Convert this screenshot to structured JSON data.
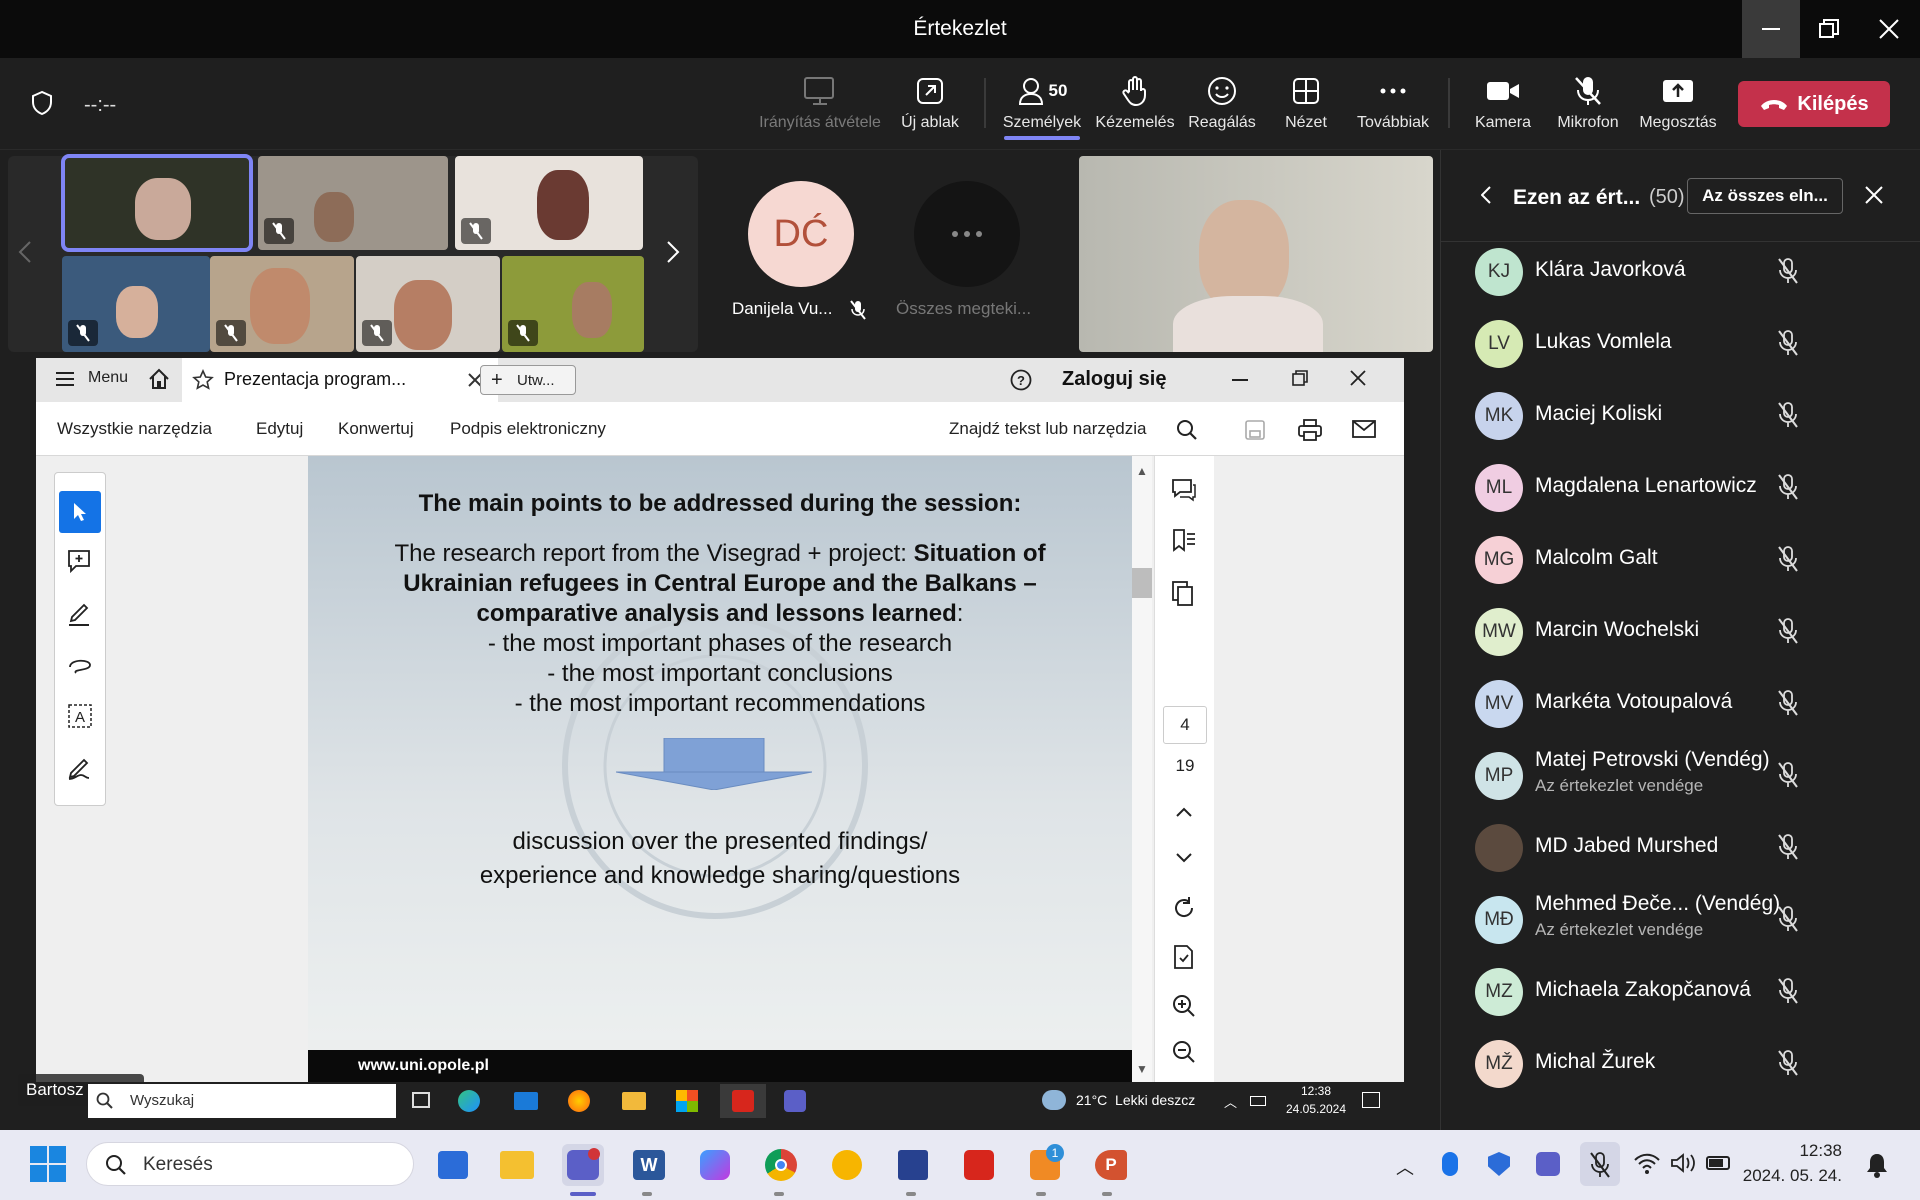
{
  "window": {
    "title": "Értekezlet"
  },
  "toolbar": {
    "timer": "--:--",
    "control": "Irányítás átvétele",
    "new_window": "Új ablak",
    "people": "Személyek",
    "people_count": "50",
    "raise_hand": "Kézemelés",
    "react": "Reagálás",
    "view": "Nézet",
    "more": "Továbbiak",
    "camera": "Kamera",
    "mic": "Mikrofon",
    "share": "Megosztás",
    "leave": "Kilépés"
  },
  "stage": {
    "participant_initials": "DĆ",
    "participant_name": "Danijela Vu...",
    "view_all": "Összes megteki...",
    "speaker_label": "Bartosz Czepil"
  },
  "panel": {
    "title": "Ezen az ért...",
    "count": "(50)",
    "mute_all": "Az összes eln...",
    "people": [
      {
        "initials": "KJ",
        "name": "Klára Javorková",
        "sub": "",
        "color": "#bfe5cf"
      },
      {
        "initials": "LV",
        "name": "Lukas Vomlela",
        "sub": "",
        "color": "#d6eab4"
      },
      {
        "initials": "MK",
        "name": "Maciej Koliski",
        "sub": "",
        "color": "#c7d3ec"
      },
      {
        "initials": "ML",
        "name": "Magdalena Lenartowicz",
        "sub": "",
        "color": "#f0cde2"
      },
      {
        "initials": "MG",
        "name": "Malcolm Galt",
        "sub": "",
        "color": "#f6d0d6"
      },
      {
        "initials": "MW",
        "name": "Marcin Wochelski",
        "sub": "",
        "color": "#e0eecd"
      },
      {
        "initials": "MV",
        "name": "Markéta Votoupalová",
        "sub": "",
        "color": "#c9d8ef"
      },
      {
        "initials": "MP",
        "name": "Matej Petrovski (Vendég)",
        "sub": "Az értekezlet vendége",
        "color": "#cfe3e6"
      },
      {
        "initials": "",
        "name": "MD Jabed Murshed",
        "sub": "",
        "color": "#5b4a3e"
      },
      {
        "initials": "MĐ",
        "name": "Mehmed Đeče...  (Vendég)",
        "sub": "Az értekezlet vendége",
        "color": "#c8e6ef"
      },
      {
        "initials": "MZ",
        "name": "Michaela Zakopčanová",
        "sub": "",
        "color": "#cdebd6"
      },
      {
        "initials": "MŽ",
        "name": "Michal Žurek",
        "sub": "",
        "color": "#f3d9cc"
      }
    ]
  },
  "acrobat": {
    "menu": "Menu",
    "tab_title": "Prezentacja program...",
    "new_tab": "Utw...",
    "sign_in": "Zaloguj się",
    "tools": [
      "Wszystkie narzędzia",
      "Edytuj",
      "Konwertuj",
      "Podpis elektroniczny"
    ],
    "search": "Znajdź tekst lub narzędzia",
    "page_current": "4",
    "page_total": "19"
  },
  "slide": {
    "heading": "The main points to be addressed during the session:",
    "line1a": "The research report from the Visegrad + project: ",
    "line1b": "Situation of",
    "line2": "Ukrainian refugees in Central Europe and the Balkans –",
    "line3a": "comparative analysis and lessons learned",
    "line3b": ":",
    "bullet1": "- the most important phases of the research",
    "bullet2": "-  the most important conclusions",
    "bullet3": "- the most important recommendations",
    "discussion1": "discussion over the presented findings/",
    "discussion2": "experience and knowledge sharing/questions",
    "footer": "www.uni.opole.pl"
  },
  "inner_taskbar": {
    "search": "Wyszukaj",
    "weather": "21°C  Lekki deszcz",
    "time": "12:38",
    "date": "24.05.2024"
  },
  "taskbar": {
    "search": "Keresés",
    "time": "12:38",
    "date": "2024. 05. 24.",
    "badge": "1"
  }
}
